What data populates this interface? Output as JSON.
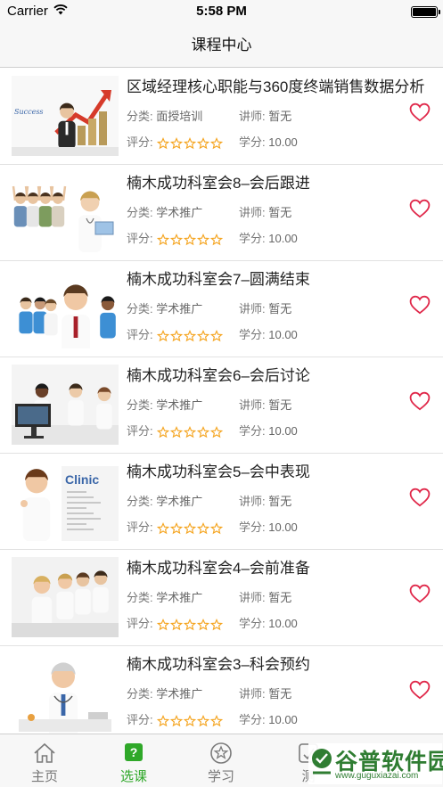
{
  "status_bar": {
    "carrier": "Carrier",
    "time": "5:58 PM"
  },
  "nav": {
    "title": "课程中心"
  },
  "course_labels": {
    "category": "分类:",
    "lecturer": "讲师:",
    "rating": "评分:",
    "credit": "学分:"
  },
  "courses": [
    {
      "title": "区域经理核心职能与360度终端销售数据分析",
      "category": "面授培训",
      "lecturer": "暂无",
      "credit": "10.00",
      "rating": 0,
      "favorited": false,
      "thumb": "business-success-chart"
    },
    {
      "title": "楠木成功科室会8–会后跟进",
      "category": "学术推广",
      "lecturer": "暂无",
      "credit": "10.00",
      "rating": 0,
      "favorited": false,
      "thumb": "cheering-team-doctor"
    },
    {
      "title": "楠木成功科室会7–圆满结束",
      "category": "学术推广",
      "lecturer": "暂无",
      "credit": "10.00",
      "rating": 0,
      "favorited": false,
      "thumb": "medical-team-smiling"
    },
    {
      "title": "楠木成功科室会6–会后讨论",
      "category": "学术推广",
      "lecturer": "暂无",
      "credit": "10.00",
      "rating": 0,
      "favorited": false,
      "thumb": "doctors-at-computer"
    },
    {
      "title": "楠木成功科室会5–会中表现",
      "category": "学术推广",
      "lecturer": "暂无",
      "credit": "10.00",
      "rating": 0,
      "favorited": false,
      "thumb": "clinic-nurse-thumbs-up"
    },
    {
      "title": "楠木成功科室会4–会前准备",
      "category": "学术推广",
      "lecturer": "暂无",
      "credit": "10.00",
      "rating": 0,
      "favorited": false,
      "thumb": "doctors-seated-row"
    },
    {
      "title": "楠木成功科室会3–科会预约",
      "category": "学术推广",
      "lecturer": "暂无",
      "credit": "10.00",
      "rating": 0,
      "favorited": false,
      "thumb": "senior-doctor-desk"
    }
  ],
  "tabs": [
    {
      "label": "主页",
      "icon": "home-icon",
      "active": false
    },
    {
      "label": "选课",
      "icon": "question-badge-icon",
      "active": true,
      "badge": "?"
    },
    {
      "label": "学习",
      "icon": "star-circle-icon",
      "active": false
    },
    {
      "label": "测",
      "icon": "test-icon",
      "active": false
    }
  ],
  "watermark": {
    "text": "谷普软件园",
    "url": "www.guguxiazai.com"
  },
  "colors": {
    "accent": "#2fa829",
    "heart": "#e0284a",
    "star": "#f5a623",
    "watermark": "#2f7d32"
  }
}
